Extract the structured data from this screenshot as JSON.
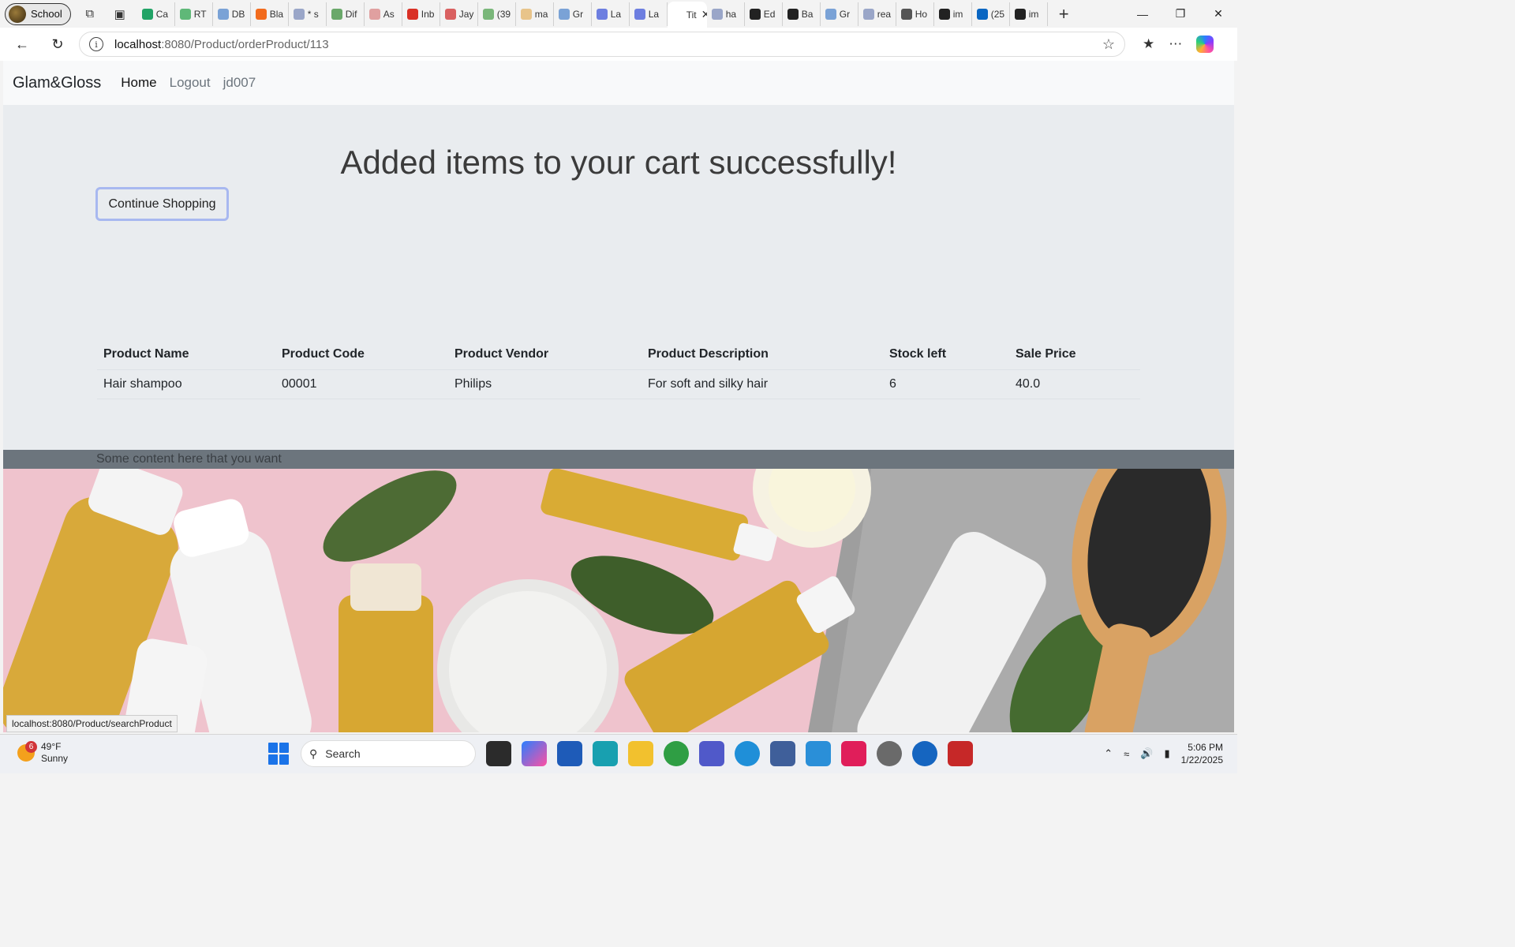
{
  "browser": {
    "profile_label": "School",
    "tabs": [
      {
        "label": "Ca",
        "color": "#21a366"
      },
      {
        "label": "RT",
        "color": "#5fb878"
      },
      {
        "label": "DB",
        "color": "#7aa2d6"
      },
      {
        "label": "Bla",
        "color": "#f26b1d"
      },
      {
        "label": "* s",
        "color": "#9aa6c8"
      },
      {
        "label": "Dif",
        "color": "#6aa86a"
      },
      {
        "label": "As",
        "color": "#e0a0a0"
      },
      {
        "label": "Inb",
        "color": "#d93025"
      },
      {
        "label": "Jay",
        "color": "#d96060"
      },
      {
        "label": "(39",
        "color": "#7ab77a"
      },
      {
        "label": "ma",
        "color": "#e8c48a"
      },
      {
        "label": "Gr",
        "color": "#7aa2d6"
      },
      {
        "label": "La",
        "color": "#6d7ee0"
      },
      {
        "label": "La",
        "color": "#6d7ee0"
      },
      {
        "label": "Tit",
        "color": "#ffffff",
        "active": true
      },
      {
        "label": "ha",
        "color": "#9aa6c8"
      },
      {
        "label": "Ed",
        "color": "#222222"
      },
      {
        "label": "Ba",
        "color": "#222222"
      },
      {
        "label": "Gr",
        "color": "#7aa2d6"
      },
      {
        "label": "rea",
        "color": "#9aa6c8"
      },
      {
        "label": "Ho",
        "color": "#555555"
      },
      {
        "label": "im",
        "color": "#222222"
      },
      {
        "label": "(25",
        "color": "#0a66c2"
      },
      {
        "label": "im",
        "color": "#222222"
      }
    ],
    "url_host": "localhost",
    "url_path": ":8080/Product/orderProduct/113",
    "status_url": "localhost:8080/Product/searchProduct",
    "copilot_badge": "1"
  },
  "nav": {
    "brand": "Glam&Gloss",
    "home": "Home",
    "logout": "Logout",
    "user": "jd007"
  },
  "main": {
    "headline": "Added items to your cart successfully!",
    "continue_label": "Continue Shopping"
  },
  "table": {
    "headers": [
      "Product Name",
      "Product Code",
      "Product Vendor",
      "Product Description",
      "Stock left",
      "Sale Price"
    ],
    "rows": [
      [
        "Hair shampoo",
        "00001",
        "Philips",
        "For soft and silky hair",
        "6",
        "40.0"
      ]
    ]
  },
  "footer": {
    "text": "Some content here that you want"
  },
  "taskbar": {
    "temperature": "49°F",
    "condition": "Sunny",
    "weather_badge": "6",
    "search_label": "Search",
    "time": "5:06 PM",
    "date": "1/22/2025"
  }
}
